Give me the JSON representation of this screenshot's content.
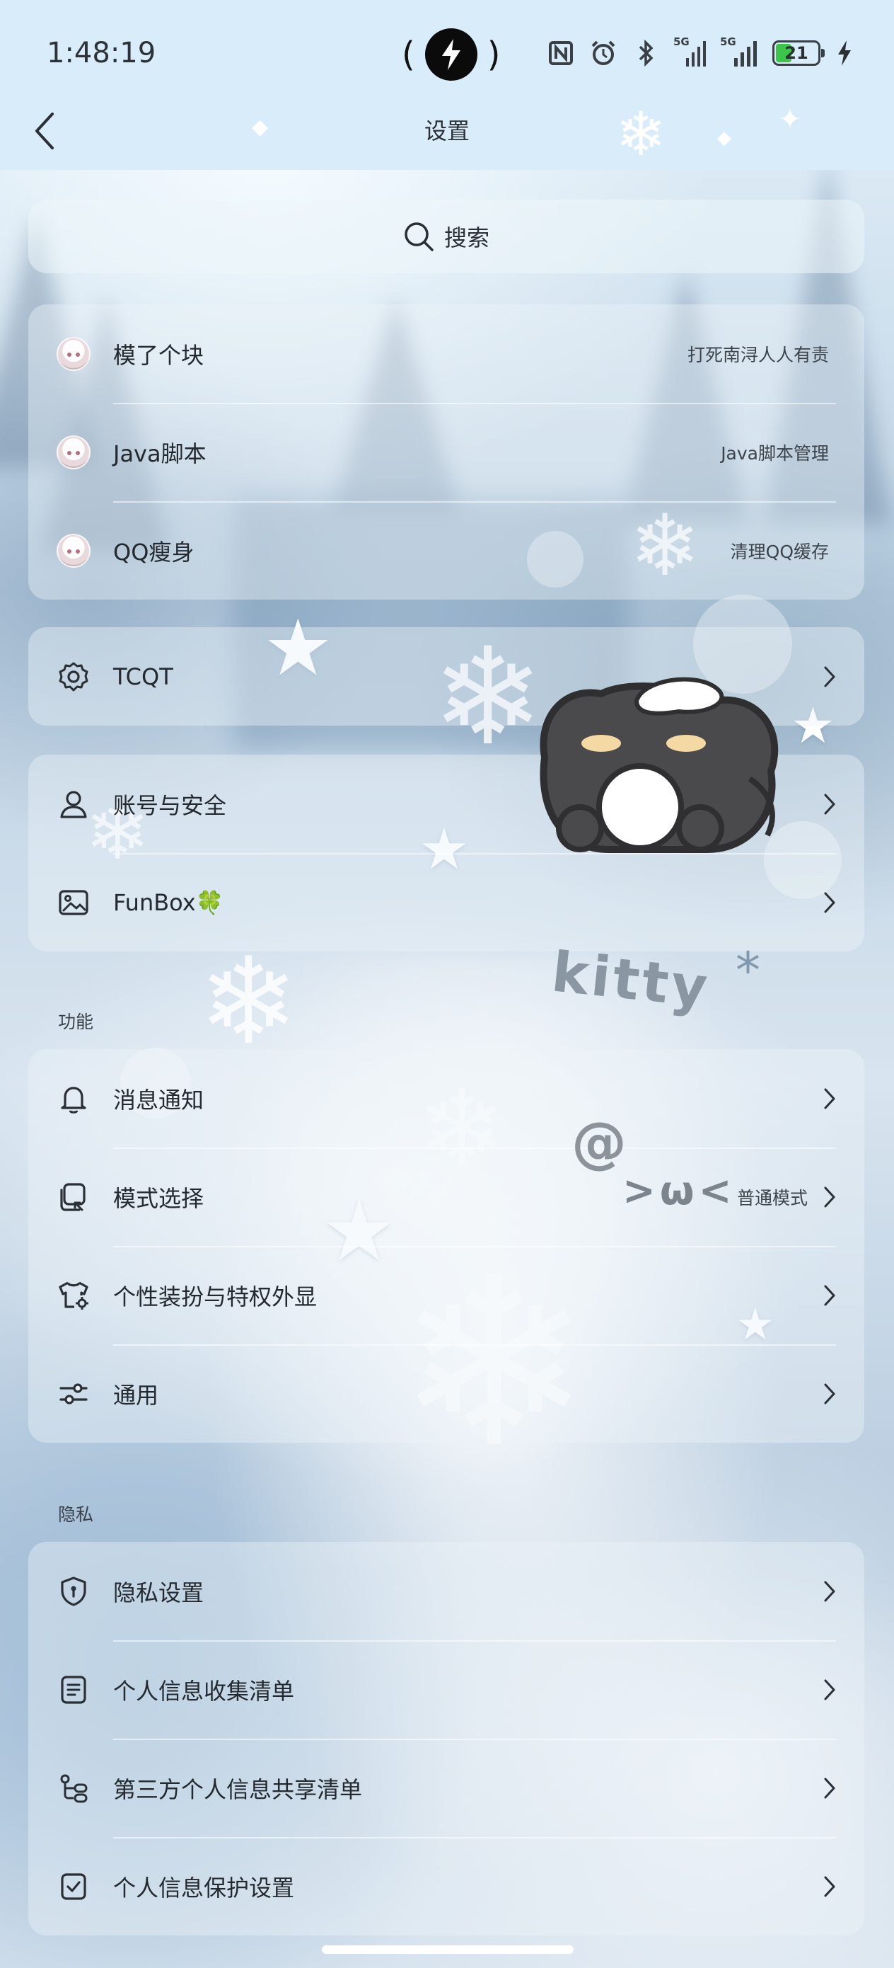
{
  "status_bar": {
    "time": "1:48:19",
    "island_left": "(",
    "island_right": ")",
    "signal1_label": "5G",
    "signal2_label": "5G",
    "battery_level": "21",
    "icons": [
      "nfc-icon",
      "alarm-icon",
      "bluetooth-icon",
      "signal-icon",
      "signal-icon",
      "battery-icon",
      "charging-icon"
    ]
  },
  "header": {
    "title": "设置",
    "back_icon": "chevron-left-icon"
  },
  "search": {
    "label": "搜索",
    "icon": "search-icon"
  },
  "plugins": [
    {
      "label": "模了个块",
      "value": "打死南浔人人有责"
    },
    {
      "label": "Java脚本",
      "value": "Java脚本管理"
    },
    {
      "label": "QQ瘦身",
      "value": "清理QQ缓存"
    }
  ],
  "tcqt": {
    "label": "TCQT",
    "icon": "gear-icon"
  },
  "account": [
    {
      "label": "账号与安全",
      "icon": "person-icon"
    },
    {
      "label": "FunBox",
      "emoji": "🍀",
      "icon": "image-icon"
    }
  ],
  "functions": {
    "section_title": "功能",
    "items": [
      {
        "label": "消息通知",
        "value": "",
        "icon": "bell-icon"
      },
      {
        "label": "模式选择",
        "value": "普通模式",
        "icon": "mode-switch-icon"
      },
      {
        "label": "个性装扮与特权外显",
        "value": "",
        "icon": "shirt-gear-icon"
      },
      {
        "label": "通用",
        "value": "",
        "icon": "sliders-icon"
      }
    ]
  },
  "privacy": {
    "section_title": "隐私",
    "items": [
      {
        "label": "隐私设置",
        "icon": "shield-icon"
      },
      {
        "label": "个人信息收集清单",
        "icon": "document-icon"
      },
      {
        "label": "第三方个人信息共享清单",
        "icon": "share-list-icon"
      },
      {
        "label": "个人信息保护设置",
        "icon": "check-square-icon"
      }
    ]
  },
  "decor": {
    "kitty_text": "kitty",
    "kitty_star": "*",
    "at_sign": "@",
    "face": ">ω<"
  },
  "colors": {
    "bar_bg": "#d9ecfa",
    "card_bg": "rgba(235,243,249,0.42)",
    "battery_green": "#3cc54a"
  }
}
